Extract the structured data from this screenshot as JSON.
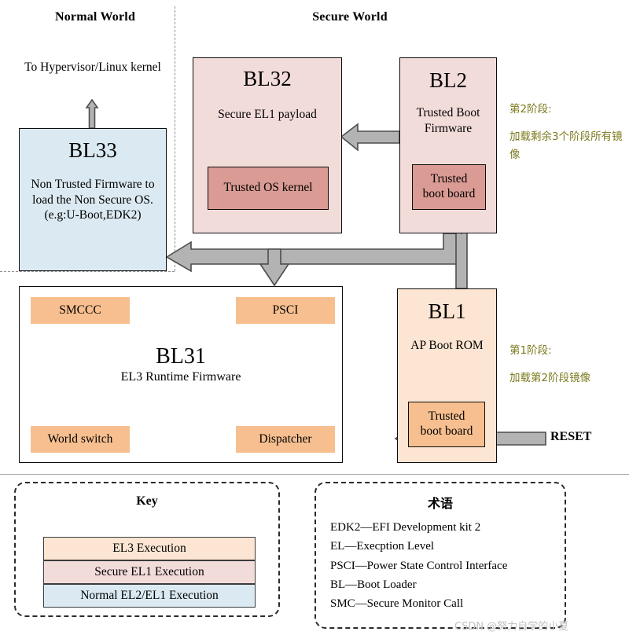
{
  "worlds": {
    "normal_title": "Normal World",
    "secure_title": "Secure World"
  },
  "labels": {
    "to_hypervisor": "To Hypervisor/Linux kernel",
    "reset": "RESET"
  },
  "blocks": {
    "bl33": {
      "title": "BL33",
      "subtitle": "Non Trusted Firmware to load the Non Secure OS. (e.g:U-Boot,EDK2)",
      "color": "#dbeaf2"
    },
    "bl32": {
      "title": "BL32",
      "subtitle": "Secure EL1 payload",
      "inner": "Trusted OS kernel",
      "color": "#f2dcda",
      "inner_color": "#d99b93"
    },
    "bl2": {
      "title": "BL2",
      "subtitle": "Trusted Boot Firmware",
      "inner_line1": "Trusted",
      "inner_line2": "boot board",
      "color": "#f2dcda",
      "inner_color": "#d99b93"
    },
    "bl31": {
      "title": "BL31",
      "subtitle": "EL3 Runtime Firmware",
      "chips": [
        "SMCCC",
        "PSCI",
        "World switch",
        "Dispatcher"
      ],
      "chip_color": "#f7bf8f"
    },
    "bl1": {
      "title": "BL1",
      "subtitle": "AP Boot ROM",
      "inner_line1": "Trusted",
      "inner_line2": "boot board",
      "color": "#fce5d2",
      "inner_color": "#f7bf8f"
    }
  },
  "notes": {
    "stage2_heading": "第2阶段:",
    "stage2_body": "加载剩余3个阶段所有镜像",
    "stage1_heading": "第1阶段:",
    "stage1_body": "加载第2阶段镜像",
    "color": "#7c7a1e"
  },
  "key": {
    "title": "Key",
    "rows": [
      {
        "label": "EL3 Execution",
        "color": "#fce5d2"
      },
      {
        "label": "Secure EL1 Execution",
        "color": "#f2dcda"
      },
      {
        "label": "Normal EL2/EL1 Execution",
        "color": "#dbeaf2"
      }
    ]
  },
  "glossary": {
    "title": "术语",
    "entries": [
      "EDK2—EFI Development kit 2",
      "EL—Execption Level",
      "PSCI—Power State Control Interface",
      "BL—Boot Loader",
      "SMC—Secure Monitor Call"
    ]
  },
  "watermark": "CSDN @努力自学的小夏",
  "arrow_color": "#b3b3b3",
  "arrow_stroke": "#4d4d4d"
}
